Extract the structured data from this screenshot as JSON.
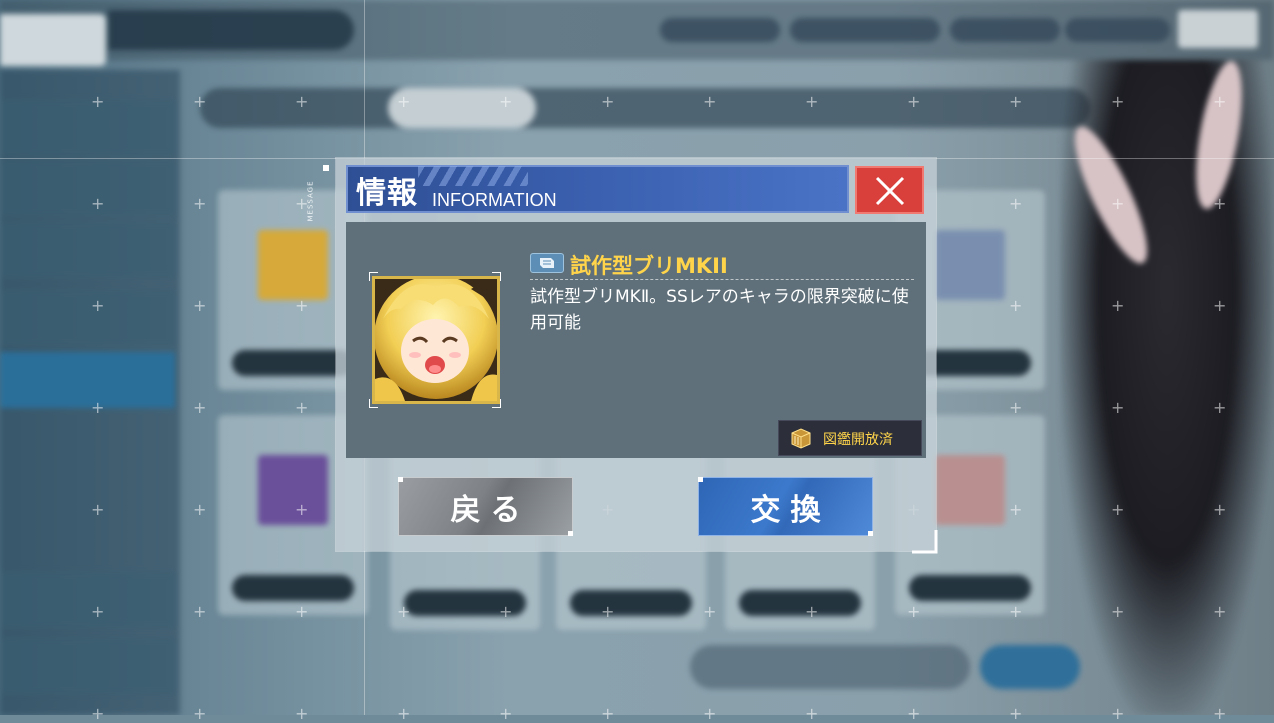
{
  "dialog": {
    "side_label": "MESSAGE",
    "title_jp": "情報",
    "title_en": "INFORMATION",
    "close_icon": "close-x-icon",
    "item": {
      "icon": "character-portrait",
      "type_icon": "ticket-icon",
      "name": "試作型ブリMKII",
      "description": "試作型ブリMKⅡ。SSレアのキャラの限界突破に使用可能"
    },
    "catalog_badge": {
      "icon": "box-icon",
      "label": "図鑑開放済"
    },
    "buttons": {
      "back_label": "戻る",
      "exchange_label": "交換"
    }
  },
  "colors": {
    "header_blue": "#3c62b2",
    "close_red": "#d9403c",
    "item_name_gold": "#ffd44a",
    "exchange_blue": "#3c79cc",
    "back_gray": "#7e8286"
  }
}
